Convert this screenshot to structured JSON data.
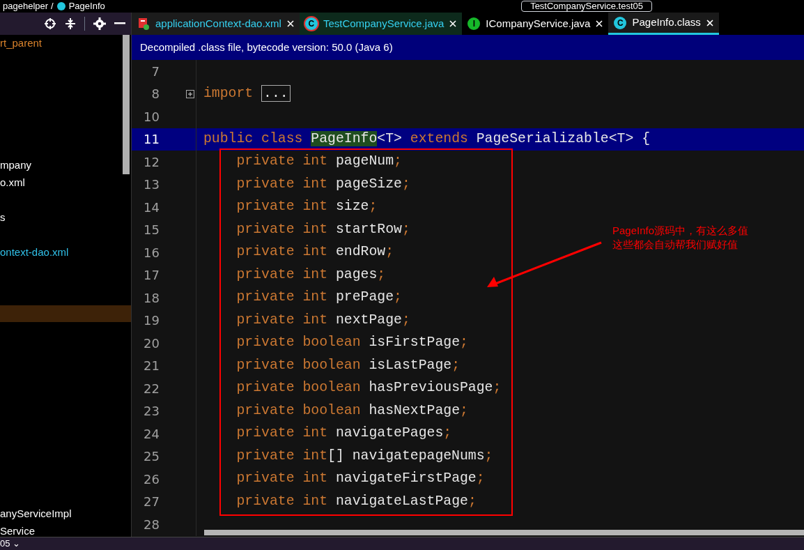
{
  "breadcrumb": [
    "pagehelper",
    "/",
    "PageInfo"
  ],
  "run_config": "TestCompanyService.test05",
  "project_tree": [
    {
      "label": "rt_parent",
      "kind": "module",
      "selected": false
    },
    {
      "label": "mpany",
      "kind": "folder",
      "selected": false
    },
    {
      "label": "o.xml",
      "kind": "folder",
      "selected": false
    },
    {
      "label": "s",
      "kind": "folder",
      "selected": false
    },
    {
      "label": "ontext-dao.xml",
      "kind": "open",
      "selected": false
    },
    {
      "kind": "selected-row",
      "selected": true
    },
    {
      "label": "anyServiceImpl",
      "kind": "folder",
      "selected": false
    },
    {
      "label": "Service",
      "kind": "folder",
      "selected": false
    }
  ],
  "tabs": [
    {
      "label": "applicationContext-dao.xml",
      "kind": "xml",
      "selected": false,
      "modified": false
    },
    {
      "label": "TestCompanyService.java",
      "kind": "class",
      "icon": "C",
      "selected": false,
      "modified": true
    },
    {
      "label": "ICompanyService.java",
      "kind": "interface",
      "icon": "I",
      "selected": false,
      "modified": false
    },
    {
      "label": "PageInfo.class",
      "kind": "class",
      "icon": "C",
      "selected": true,
      "modified": false
    }
  ],
  "info_bar": "Decompiled .class file, bytecode version: 50.0 (Java 6)",
  "code_lines": [
    {
      "number": "7",
      "selected": false,
      "folded": false
    },
    {
      "number": "8",
      "selected": false,
      "folded": true,
      "tokens": [
        {
          "kind": "kw",
          "text": "import "
        },
        {
          "kind": "fold",
          "text": "..."
        }
      ]
    },
    {
      "number": "10",
      "selected": false,
      "folded": false
    },
    {
      "number": "11",
      "selected": true,
      "folded": false,
      "tokens": [
        {
          "kind": "kw",
          "text": "public class "
        },
        {
          "kind": "match",
          "text": "PageInfo"
        },
        {
          "kind": "id",
          "text": "<T> "
        },
        {
          "kind": "kw",
          "text": "extends "
        },
        {
          "kind": "id",
          "text": "PageSerializable<T> {"
        }
      ]
    },
    {
      "number": "12",
      "selected": false,
      "folded": false,
      "tokens": [
        {
          "kind": "kw",
          "text": "    private int "
        },
        {
          "kind": "id",
          "text": "pageNum"
        },
        {
          "kind": "kw",
          "text": ";"
        }
      ]
    },
    {
      "number": "13",
      "selected": false,
      "folded": false,
      "tokens": [
        {
          "kind": "kw",
          "text": "    private int "
        },
        {
          "kind": "id",
          "text": "pageSize"
        },
        {
          "kind": "kw",
          "text": ";"
        }
      ]
    },
    {
      "number": "14",
      "selected": false,
      "folded": false,
      "tokens": [
        {
          "kind": "kw",
          "text": "    private int "
        },
        {
          "kind": "id",
          "text": "size"
        },
        {
          "kind": "kw",
          "text": ";"
        }
      ]
    },
    {
      "number": "15",
      "selected": false,
      "folded": false,
      "tokens": [
        {
          "kind": "kw",
          "text": "    private int "
        },
        {
          "kind": "id",
          "text": "startRow"
        },
        {
          "kind": "kw",
          "text": ";"
        }
      ]
    },
    {
      "number": "16",
      "selected": false,
      "folded": false,
      "tokens": [
        {
          "kind": "kw",
          "text": "    private int "
        },
        {
          "kind": "id",
          "text": "endRow"
        },
        {
          "kind": "kw",
          "text": ";"
        }
      ]
    },
    {
      "number": "17",
      "selected": false,
      "folded": false,
      "tokens": [
        {
          "kind": "kw",
          "text": "    private int "
        },
        {
          "kind": "id",
          "text": "pages"
        },
        {
          "kind": "kw",
          "text": ";"
        }
      ]
    },
    {
      "number": "18",
      "selected": false,
      "folded": false,
      "tokens": [
        {
          "kind": "kw",
          "text": "    private int "
        },
        {
          "kind": "id",
          "text": "prePage"
        },
        {
          "kind": "kw",
          "text": ";"
        }
      ]
    },
    {
      "number": "19",
      "selected": false,
      "folded": false,
      "tokens": [
        {
          "kind": "kw",
          "text": "    private int "
        },
        {
          "kind": "id",
          "text": "nextPage"
        },
        {
          "kind": "kw",
          "text": ";"
        }
      ]
    },
    {
      "number": "20",
      "selected": false,
      "folded": false,
      "tokens": [
        {
          "kind": "kw",
          "text": "    private boolean "
        },
        {
          "kind": "id",
          "text": "isFirstPage"
        },
        {
          "kind": "kw",
          "text": ";"
        }
      ]
    },
    {
      "number": "21",
      "selected": false,
      "folded": false,
      "tokens": [
        {
          "kind": "kw",
          "text": "    private boolean "
        },
        {
          "kind": "id",
          "text": "isLastPage"
        },
        {
          "kind": "kw",
          "text": ";"
        }
      ]
    },
    {
      "number": "22",
      "selected": false,
      "folded": false,
      "tokens": [
        {
          "kind": "kw",
          "text": "    private boolean "
        },
        {
          "kind": "id",
          "text": "hasPreviousPage"
        },
        {
          "kind": "kw",
          "text": ";"
        }
      ]
    },
    {
      "number": "23",
      "selected": false,
      "folded": false,
      "tokens": [
        {
          "kind": "kw",
          "text": "    private boolean "
        },
        {
          "kind": "id",
          "text": "hasNextPage"
        },
        {
          "kind": "kw",
          "text": ";"
        }
      ]
    },
    {
      "number": "24",
      "selected": false,
      "folded": false,
      "tokens": [
        {
          "kind": "kw",
          "text": "    private int "
        },
        {
          "kind": "id",
          "text": "navigatePages"
        },
        {
          "kind": "kw",
          "text": ";"
        }
      ]
    },
    {
      "number": "25",
      "selected": false,
      "folded": false,
      "tokens": [
        {
          "kind": "kw",
          "text": "    private int"
        },
        {
          "kind": "id",
          "text": "[] navigatepageNums"
        },
        {
          "kind": "kw",
          "text": ";"
        }
      ]
    },
    {
      "number": "26",
      "selected": false,
      "folded": false,
      "tokens": [
        {
          "kind": "kw",
          "text": "    private int "
        },
        {
          "kind": "id",
          "text": "navigateFirstPage"
        },
        {
          "kind": "kw",
          "text": ";"
        }
      ]
    },
    {
      "number": "27",
      "selected": false,
      "folded": false,
      "tokens": [
        {
          "kind": "kw",
          "text": "    private int "
        },
        {
          "kind": "id",
          "text": "navigateLastPage"
        },
        {
          "kind": "kw",
          "text": ";"
        }
      ]
    },
    {
      "number": "28",
      "selected": false,
      "folded": false
    }
  ],
  "annotation": {
    "lines": [
      "PageInfo源码中，有这么多值",
      "这些都会自动帮我们赋好值"
    ]
  },
  "status_bar": {
    "left": "05 ⌄"
  }
}
